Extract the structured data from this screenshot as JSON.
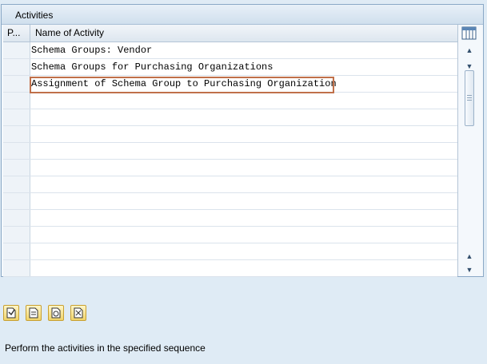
{
  "window": {
    "title": "Activities"
  },
  "table": {
    "columns": [
      "P...",
      "Name of Activity"
    ],
    "rows": [
      "Schema Groups: Vendor",
      "Schema Groups for Purchasing Organizations",
      "Assignment of Schema Group to Purchasing Organization",
      "",
      "",
      "",
      "",
      "",
      "",
      "",
      "",
      "",
      "",
      ""
    ],
    "selected_row": 2
  },
  "status": {
    "text": "Perform the activities in the specified sequence"
  },
  "icons": [
    "column-config-icon",
    "execute-icon",
    "document-icon",
    "history-icon",
    "info-icon"
  ]
}
